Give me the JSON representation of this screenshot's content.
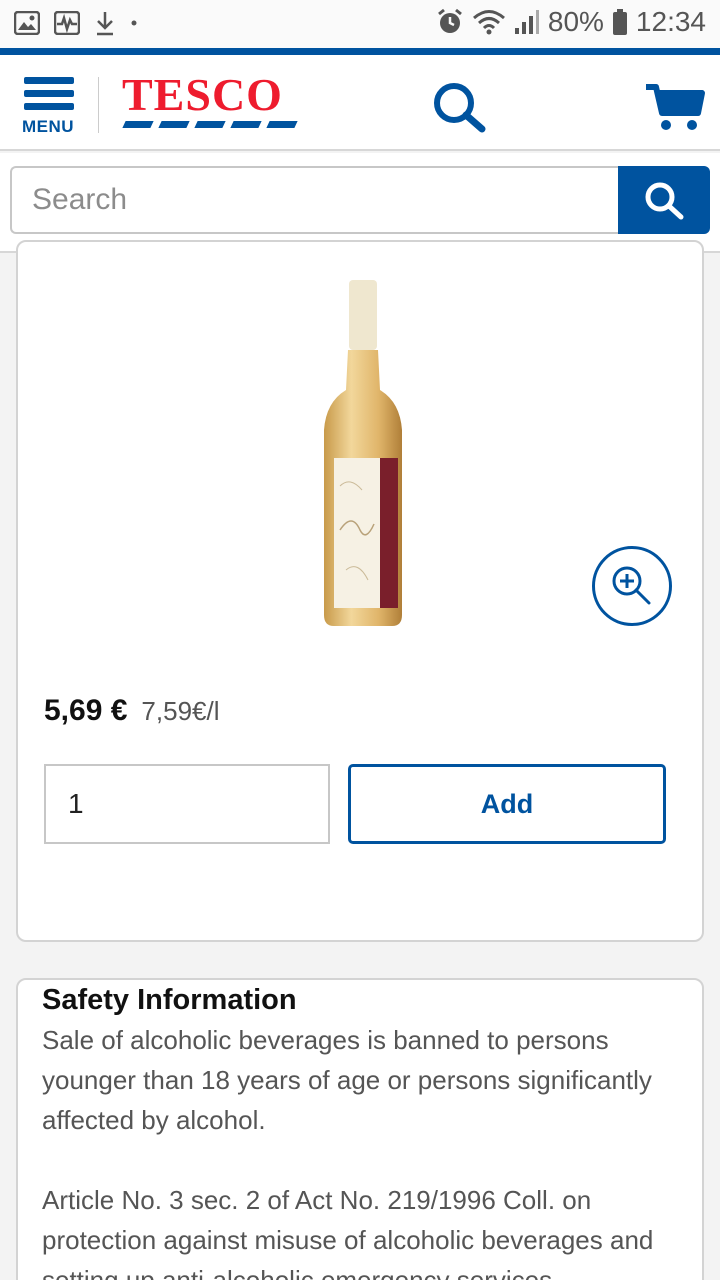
{
  "status_bar": {
    "battery": "80%",
    "time": "12:34",
    "left_icons": [
      "gallery-icon",
      "activity-icon",
      "download-icon",
      "dot-icon"
    ],
    "right_icons": [
      "alarm-icon",
      "wifi-icon",
      "signal-icon",
      "battery-icon"
    ]
  },
  "header": {
    "menu_label": "MENU",
    "logo_text": "TESCO",
    "search_icon": "search-icon",
    "cart_icon": "cart-icon"
  },
  "search": {
    "placeholder": "Search",
    "button_icon": "search-icon"
  },
  "product": {
    "price": "5,69 €",
    "unit_price": "7,59€/l",
    "quantity": "1",
    "add_label": "Add",
    "zoom_icon": "zoom-in-icon"
  },
  "safety": {
    "title": "Safety Information",
    "paragraph_1": "Sale of alcoholic beverages is banned to persons younger than 18 years of age or persons significantly affected by alcohol.",
    "paragraph_2": "Article No. 3 sec. 2 of Act No. 219/1996 Coll. on protection against misuse of alcoholic beverages and setting up anti-alcoholic emergency services"
  },
  "colors": {
    "brand_blue": "#00539f",
    "brand_red": "#ee1c2e"
  }
}
